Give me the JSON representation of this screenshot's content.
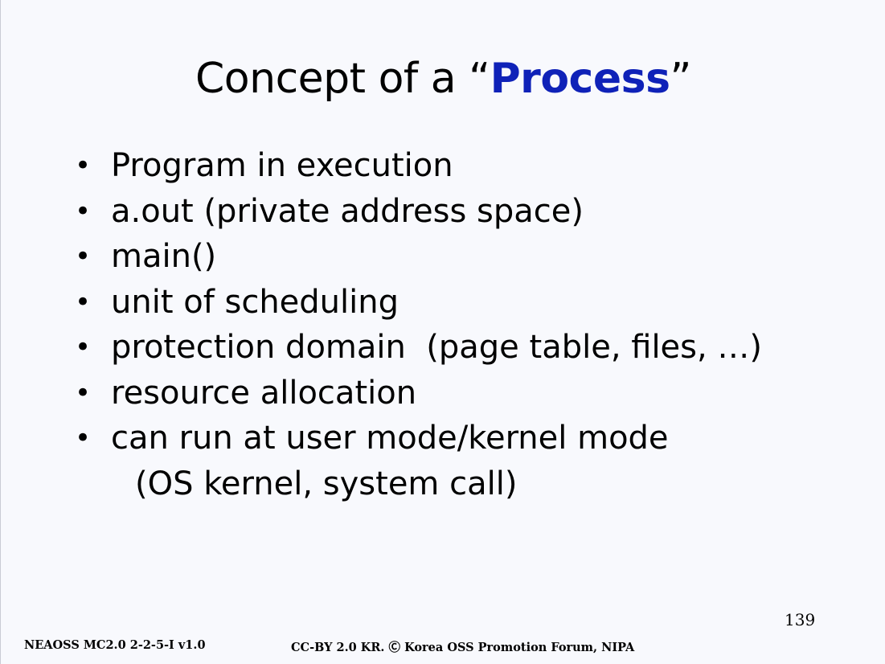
{
  "slide": {
    "title_prefix": "Concept of a “",
    "title_highlight": "Process",
    "title_suffix": "”",
    "highlight_color": "#0f22b8",
    "bullet_glyph": "•",
    "bullets": [
      "Program in execution",
      "a.out (private address space)",
      "main()",
      "unit of scheduling",
      "protection domain  (page table, files, …)",
      "resource allocation",
      "can run at user mode/kernel mode"
    ],
    "bullet_continuation": "(OS kernel, system call)",
    "page_number": "139"
  },
  "footer": {
    "left": "NEAOSS MC2.0 2-2-5-I v1.0",
    "center": "CC-BY 2.0 KR. Ⓒ Korea OSS Promotion Forum, NIPA"
  }
}
